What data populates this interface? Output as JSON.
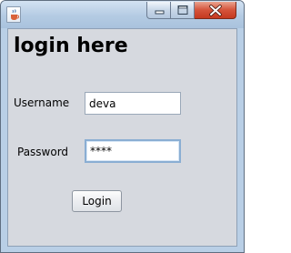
{
  "window": {
    "app_icon": "java-cup-icon",
    "controls": {
      "minimize_icon": "minimize-icon",
      "maximize_icon": "maximize-icon",
      "close_icon": "close-icon"
    }
  },
  "form": {
    "heading": "login here",
    "username": {
      "label": "Username",
      "value": "deva"
    },
    "password": {
      "label": "Password",
      "masked_value": "****",
      "focused": true
    },
    "login_button_label": "Login"
  },
  "colors": {
    "titlebar": "#b4cbe3",
    "client_background": "#d6d9df",
    "close_button": "#d5533a",
    "focus_border": "#8aaed3"
  }
}
